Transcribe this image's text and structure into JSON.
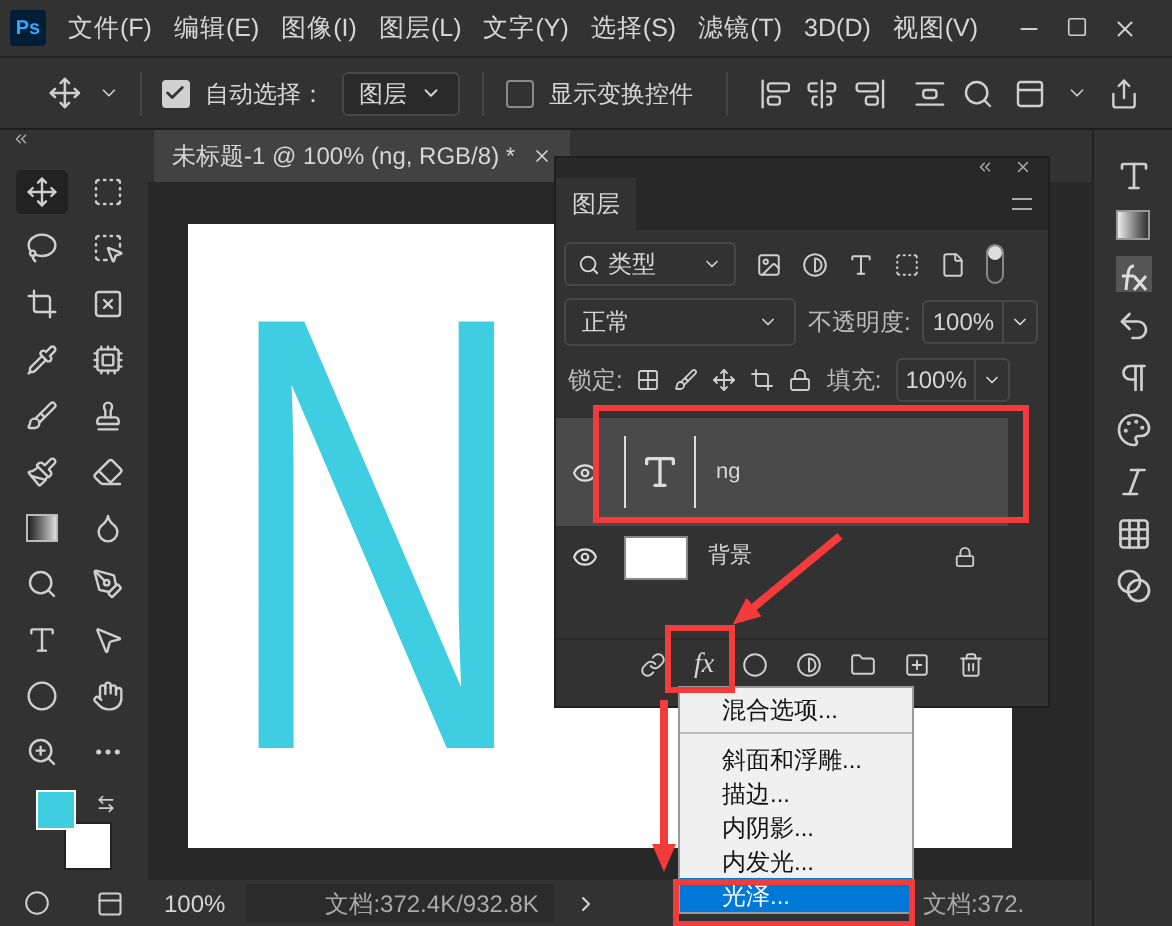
{
  "app_logo": "Ps",
  "menu": [
    "文件(F)",
    "编辑(E)",
    "图像(I)",
    "图层(L)",
    "文字(Y)",
    "选择(S)",
    "滤镜(T)",
    "3D(D)",
    "视图(V)"
  ],
  "options_bar": {
    "auto_select": {
      "label": "自动选择：",
      "checked": true
    },
    "target": "图层",
    "show_transform": {
      "label": "显示变换控件",
      "checked": false
    }
  },
  "document": {
    "tab_title": "未标题-1 @ 100% (ng, RGB/8) *",
    "canvas_text": "N"
  },
  "layers_panel": {
    "tab": "图层",
    "filter": "类型",
    "blend_mode": "正常",
    "opacity_label": "不透明度:",
    "opacity": "100%",
    "lock_label": "锁定:",
    "fill_label": "填充:",
    "fill": "100%",
    "layers": [
      {
        "name": "ng",
        "kind": "text",
        "visible": true,
        "selected": true,
        "locked": false
      },
      {
        "name": "背景",
        "kind": "image",
        "visible": true,
        "selected": false,
        "locked": true
      }
    ],
    "fx_button": "fx"
  },
  "effects_menu": {
    "groups": [
      [
        {
          "label": "混合选项...",
          "selected": false
        }
      ],
      [
        {
          "label": "斜面和浮雕...",
          "selected": false
        },
        {
          "label": "描边...",
          "selected": false
        },
        {
          "label": "内阴影...",
          "selected": false
        },
        {
          "label": "内发光...",
          "selected": false
        },
        {
          "label": "光泽...",
          "selected": true
        }
      ]
    ]
  },
  "status_bar": {
    "zoom": "100%",
    "doc_size": "文档:372.4K/932.8K",
    "doc_size_2": "文档:372."
  }
}
